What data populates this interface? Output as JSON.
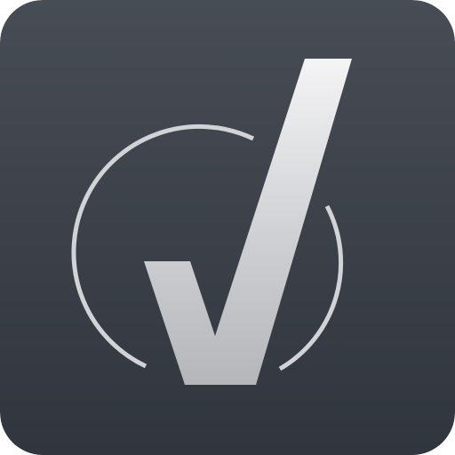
{
  "icon": {
    "name": "checkmark-circle-app-icon",
    "colors": {
      "background_top": "#474c55",
      "background_bottom": "#30353e",
      "mark_light": "#f4f4f5",
      "mark_mid": "#cfd0d3",
      "mark_dark": "#b4b6ba",
      "ring": "#d2d3d6"
    }
  }
}
